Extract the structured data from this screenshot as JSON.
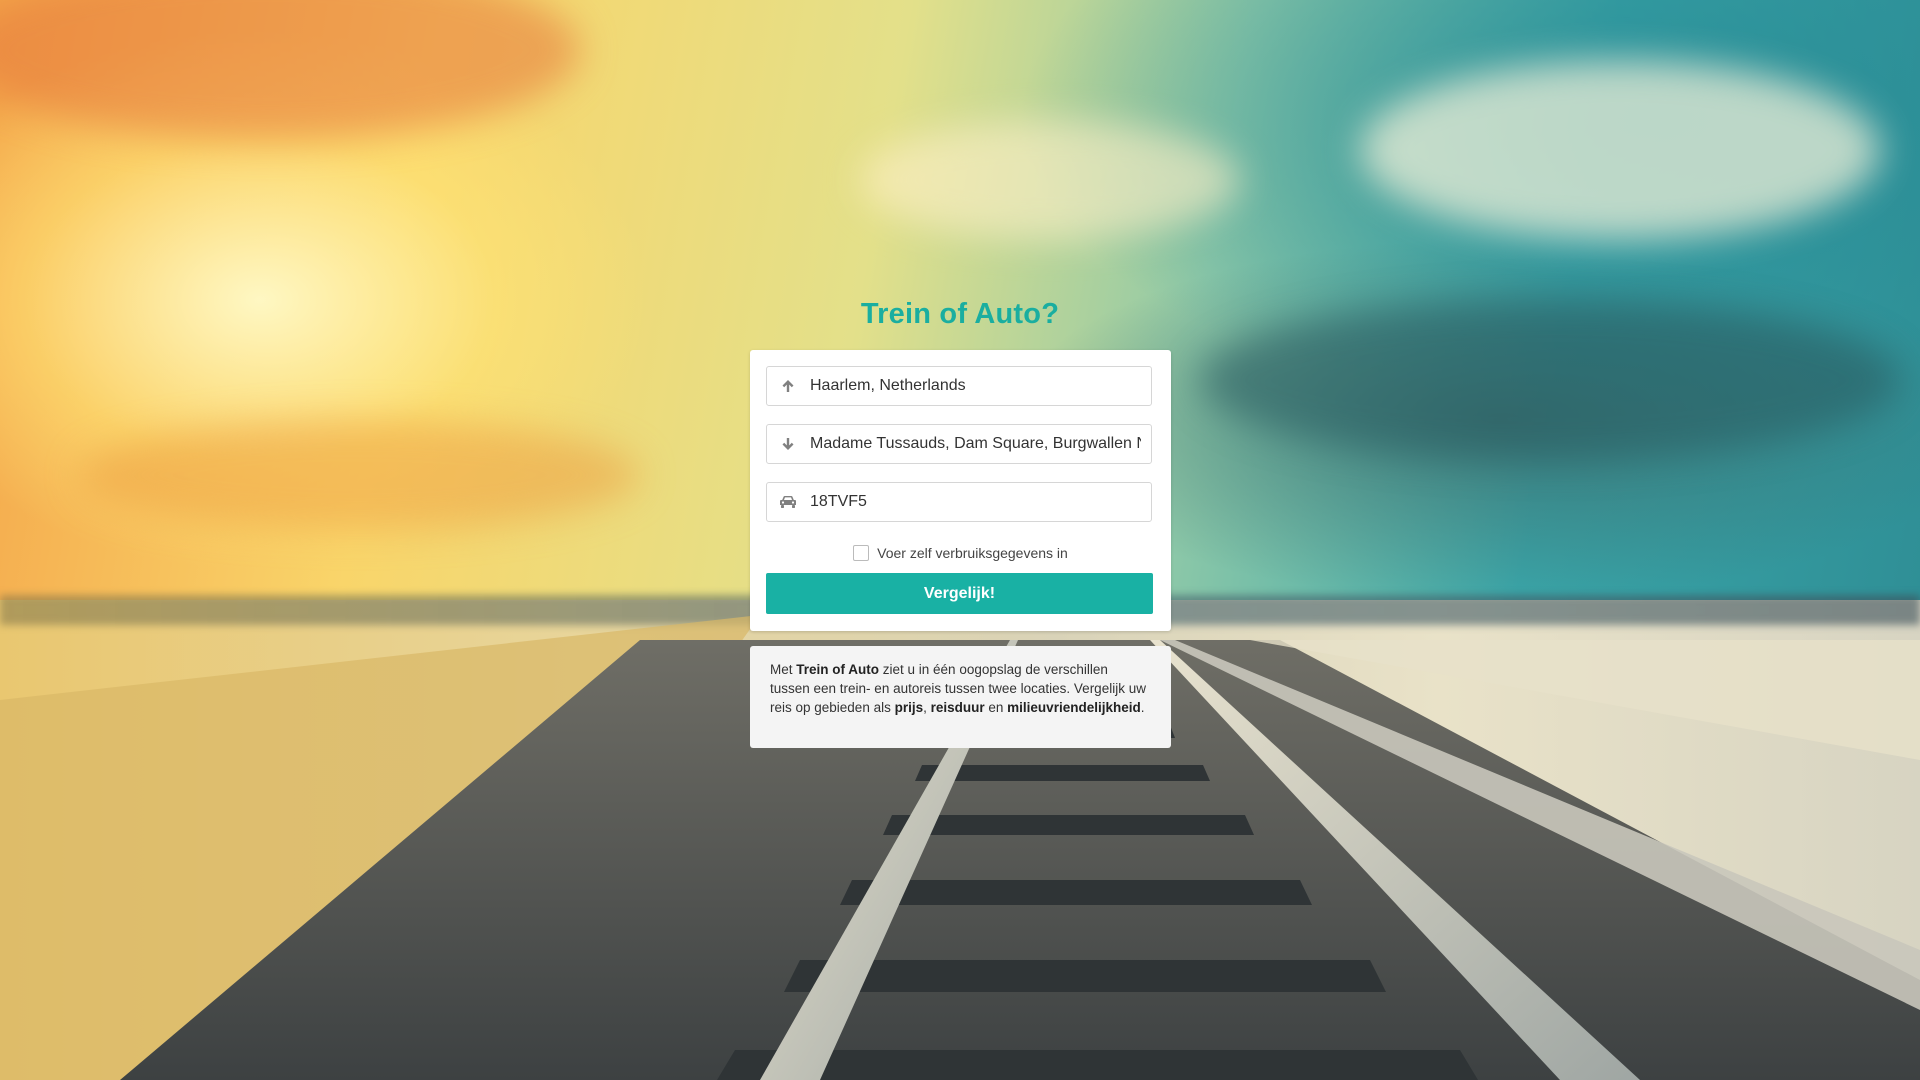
{
  "app": {
    "title": "Trein of Auto?"
  },
  "form": {
    "from_value": "Haarlem, Netherlands",
    "to_value": "Madame Tussauds, Dam Square, Burgwallen Ni",
    "plate_value": "18TVF5",
    "checkbox_label": "Voer zelf verbruiksgegevens in",
    "checkbox_checked": false,
    "submit_label": "Vergelijk!"
  },
  "info": {
    "p1": "Met ",
    "b1": "Trein of Auto",
    "p2": " ziet u in één oogopslag de verschillen tussen een trein- en autoreis tussen twee locaties. Vergelijk uw reis op gebieden als ",
    "b2": "prijs",
    "p3": ", ",
    "b3": "reisduur",
    "p4": " en ",
    "b4": "milieuvriendelijkheid",
    "p5": "."
  },
  "icons": {
    "from": "arrow-up-icon",
    "to": "arrow-down-icon",
    "car": "car-icon"
  },
  "colors": {
    "accent": "#19b1a4",
    "title": "#1aaea0"
  }
}
